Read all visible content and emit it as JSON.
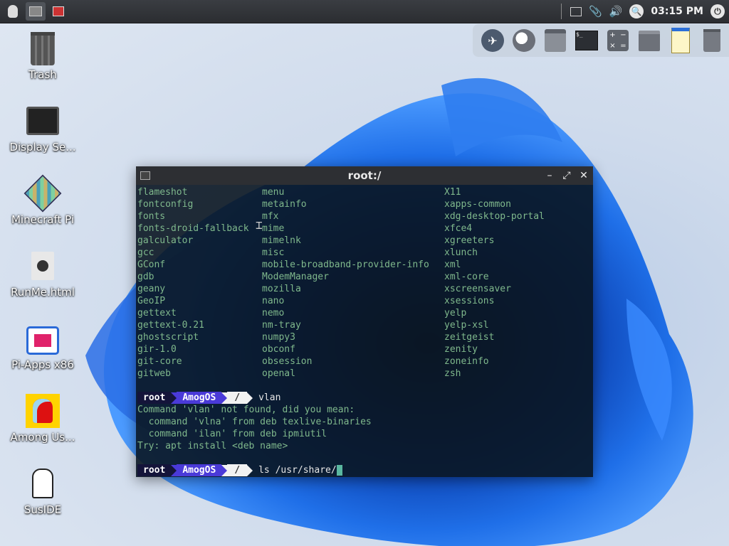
{
  "panel": {
    "clock": "03:15 PM"
  },
  "desktop_icons": [
    {
      "label": "Trash",
      "icon": "trash-icon"
    },
    {
      "label": "Display Se...",
      "icon": "monitor-icon"
    },
    {
      "label": "Minecraft Pi",
      "icon": "minecraft-icon"
    },
    {
      "label": "RunMe.html",
      "icon": "html-file-icon"
    },
    {
      "label": "Pi-Apps x86",
      "icon": "pi-apps-icon"
    },
    {
      "label": "Among Us...",
      "icon": "among-us-icon"
    },
    {
      "label": "SusIDE",
      "icon": "suside-icon"
    }
  ],
  "terminal": {
    "title": "root:/",
    "listing": {
      "col1": [
        "flameshot",
        "fontconfig",
        "fonts",
        "fonts-droid-fallback",
        "galculator",
        "gcc",
        "GConf",
        "gdb",
        "geany",
        "GeoIP",
        "gettext",
        "gettext-0.21",
        "ghostscript",
        "gir-1.0",
        "git-core",
        "gitweb"
      ],
      "col2": [
        "menu",
        "metainfo",
        "mfx",
        "mime",
        "mimelnk",
        "misc",
        "mobile-broadband-provider-info",
        "ModemManager",
        "mozilla",
        "nano",
        "nemo",
        "nm-tray",
        "numpy3",
        "obconf",
        "obsession",
        "openal"
      ],
      "col3": [
        "X11",
        "xapps-common",
        "xdg-desktop-portal",
        "xfce4",
        "xgreeters",
        "xlunch",
        "xml",
        "xml-core",
        "xscreensaver",
        "xsessions",
        "yelp",
        "yelp-xsl",
        "zeitgeist",
        "zenity",
        "zoneinfo",
        "zsh"
      ]
    },
    "prompt": {
      "user": "root",
      "host": "AmogOS",
      "dir": "/"
    },
    "command1": "vlan",
    "output": [
      "Command 'vlan' not found, did you mean:",
      "  command 'vlna' from deb texlive-binaries",
      "  command 'ilan' from deb ipmiutil",
      "Try: apt install <deb name>"
    ],
    "command2": "ls /usr/share/"
  },
  "colors": {
    "prompt_user_bg": "#14143a",
    "prompt_host_bg": "#4a3ad8",
    "prompt_dir_bg": "#f2f2f2",
    "terminal_text": "#7fb88c"
  }
}
